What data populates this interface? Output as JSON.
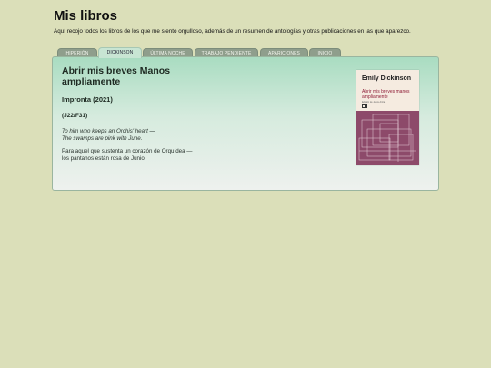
{
  "header": {
    "title": "Mis libros",
    "intro": "Aquí recojo todos los libros de los que me siento orgulloso, además de un resumen de antologías y otras publicaciones en las que aparezco."
  },
  "tabs": [
    {
      "label": "HIPERIÓN",
      "active": false
    },
    {
      "label": "DICKINSON",
      "active": true
    },
    {
      "label": "ÚLTIMA NOCHE",
      "active": false
    },
    {
      "label": "TRABAJO PENDIENTE",
      "active": false
    },
    {
      "label": "APARICIONES",
      "active": false
    },
    {
      "label": "INICIO",
      "active": false
    }
  ],
  "content": {
    "title": "Abrir mis breves Manos ampliamente",
    "edition": "Impronta (2021)",
    "code": "(J22/F31)",
    "poem_en": [
      "To him who keeps an Orchis' heart —",
      "The swamps are pink with June."
    ],
    "poem_es": [
      "Para aquel que sustenta un corazón de Orquídea —",
      "los pantanos están rosa de Junio."
    ]
  },
  "cover": {
    "author": "Emily Dickinson",
    "title": "Abrir mis breves manos ampliamente",
    "subtitle": "Edición de Jesús Ariza",
    "colors": {
      "top": "#f5ebe0",
      "bottom": "#8d4a6a",
      "title": "#8e1b35"
    }
  },
  "colors": {
    "background": "#dbdfb9",
    "tab": "#8f9e8c",
    "tab_active": "#c8e5d3",
    "panel_top": "#a9dcc1",
    "panel_bottom": "#eef1ee"
  }
}
